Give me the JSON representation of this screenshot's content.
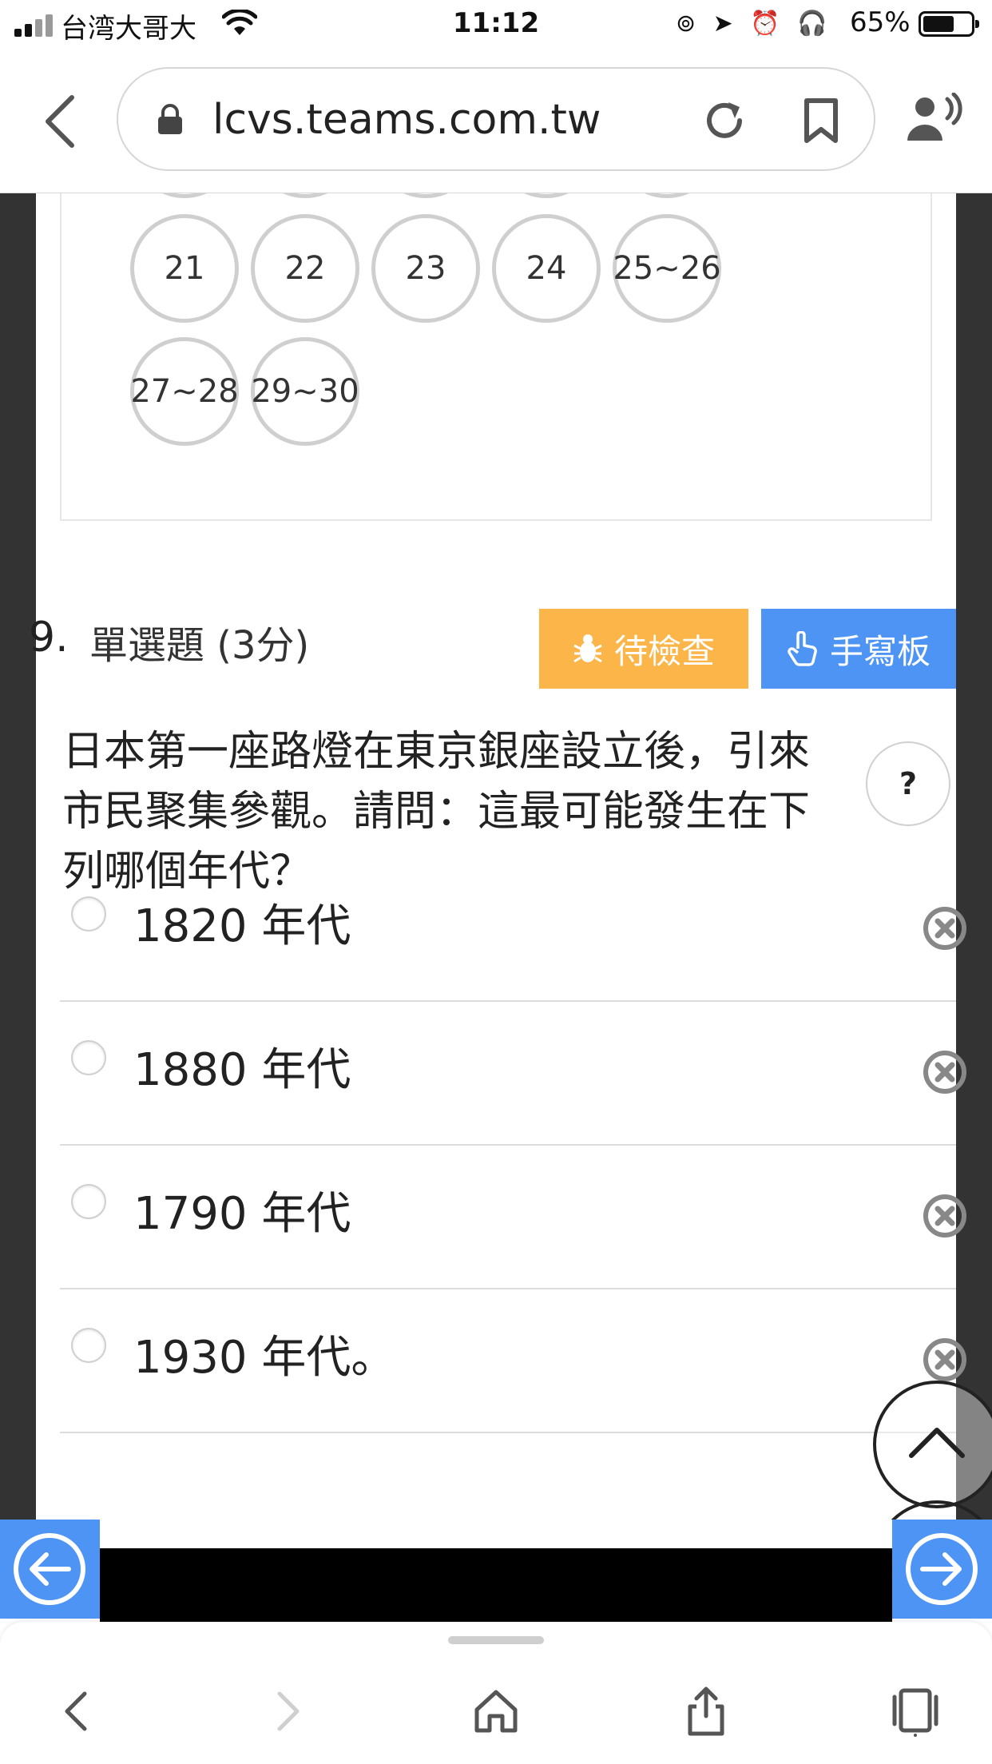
{
  "status_bar": {
    "carrier": "台湾大哥大",
    "time": "11:12",
    "battery": "65%"
  },
  "browser": {
    "url": "lcvs.teams.com.tw"
  },
  "question_nav": {
    "items": [
      "21",
      "22",
      "23",
      "24",
      "25~26",
      "27~28",
      "29~30"
    ]
  },
  "question": {
    "number": "9.",
    "type": "單選題 (3分)",
    "pending_label": "待檢查",
    "handwrite_label": "手寫板",
    "help_label": "?",
    "text": "日本第一座路燈在東京銀座設立後，引來市民聚集參觀。請問：這最可能發生在下列哪個年代？",
    "options": [
      {
        "label": "1820 年代"
      },
      {
        "label": "1880 年代"
      },
      {
        "label": "1790 年代"
      },
      {
        "label": "1930 年代。"
      }
    ]
  },
  "colors": {
    "pending": "#fbb548",
    "handwrite": "#4d94f5",
    "nav_arrow": "#4d94f5",
    "sidebar": "#333333"
  },
  "icons": [
    "signal-icon",
    "wifi-icon",
    "lock-icon",
    "reload-icon",
    "bookmark-icon",
    "speaker-icon",
    "bug-icon",
    "hand-pointer-icon",
    "remove-option-icon",
    "arrow-left-circle-icon",
    "arrow-right-circle-icon",
    "chevron-up-icon",
    "home-icon",
    "share-icon",
    "tabs-icon"
  ]
}
